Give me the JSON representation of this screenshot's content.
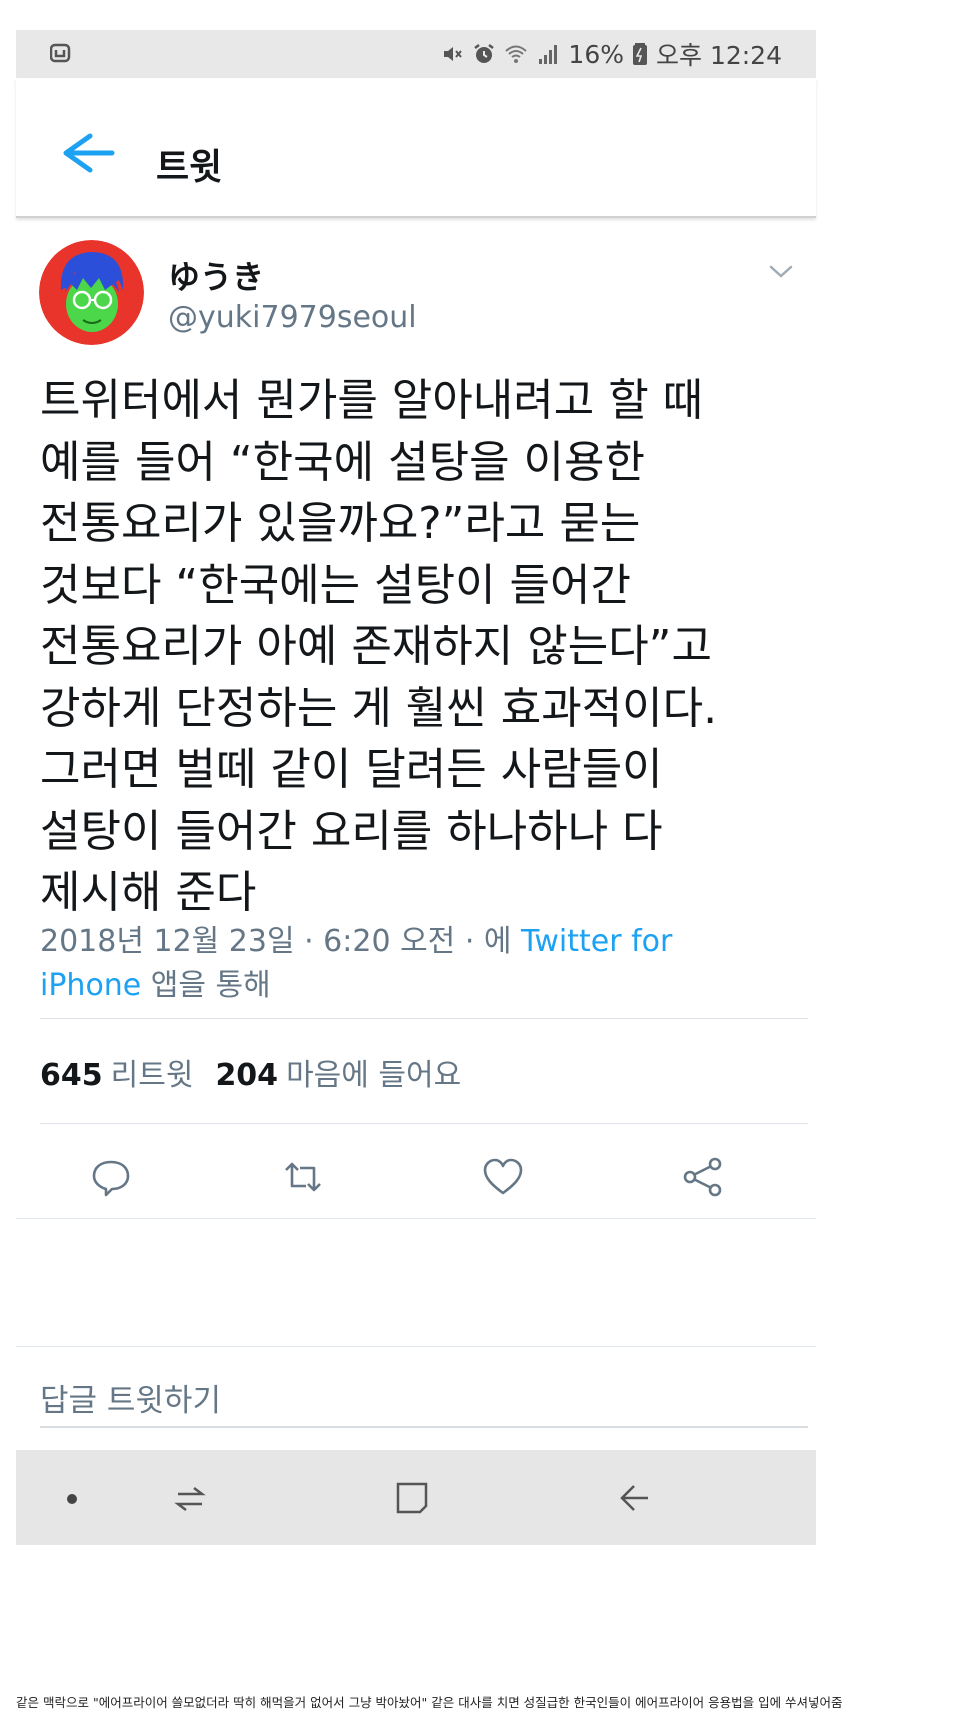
{
  "status_bar": {
    "battery": "16%",
    "time": "오후 12:24",
    "icons": [
      "mute-icon",
      "alarm-icon",
      "wifi-icon",
      "signal-icon",
      "battery-icon"
    ]
  },
  "header": {
    "title": "트윗"
  },
  "tweet": {
    "display_name": "ゆうき",
    "handle": "@yuki7979seoul",
    "text": "트위터에서 뭔가를 알아내려고 할 때\n예를 들어 “한국에 설탕을 이용한\n전통요리가 있을까요?”라고 묻는\n것보다  “한국에는 설탕이 들어간\n전통요리가 아예 존재하지 않는다”고\n강하게 단정하는 게 훨씬 효과적이다.\n그러면 벌떼 같이 달려든 사람들이\n설탕이 들어간 요리를 하나하나 다\n제시해 준다",
    "timestamp": "2018년 12월 23일 · 6:20 오전 · 에 ",
    "source": "Twitter for iPhone",
    "source_suffix": " 앱을 통해",
    "retweet_count": "645",
    "retweet_label": "리트윗",
    "like_count": "204",
    "like_label": "마음에 들어요"
  },
  "actions": [
    "reply-icon",
    "retweet-icon",
    "like-icon",
    "share-icon"
  ],
  "reply": {
    "placeholder": "답글 트윗하기"
  },
  "nav_bar": [
    "dot-icon",
    "recent-apps-icon",
    "home-icon",
    "back-icon"
  ],
  "caption": "같은 맥락으로 \"에어프라이어 쓸모없더라 딱히 해먹을거 없어서 그냥 박아놨어\" 같은 대사를 치면 성질급한 한국인들이 에어프라이어 응용법을 입에 쑤셔넣어줌",
  "colors": {
    "accent": "#1da1f2",
    "muted": "#657786",
    "text": "#14171a"
  }
}
